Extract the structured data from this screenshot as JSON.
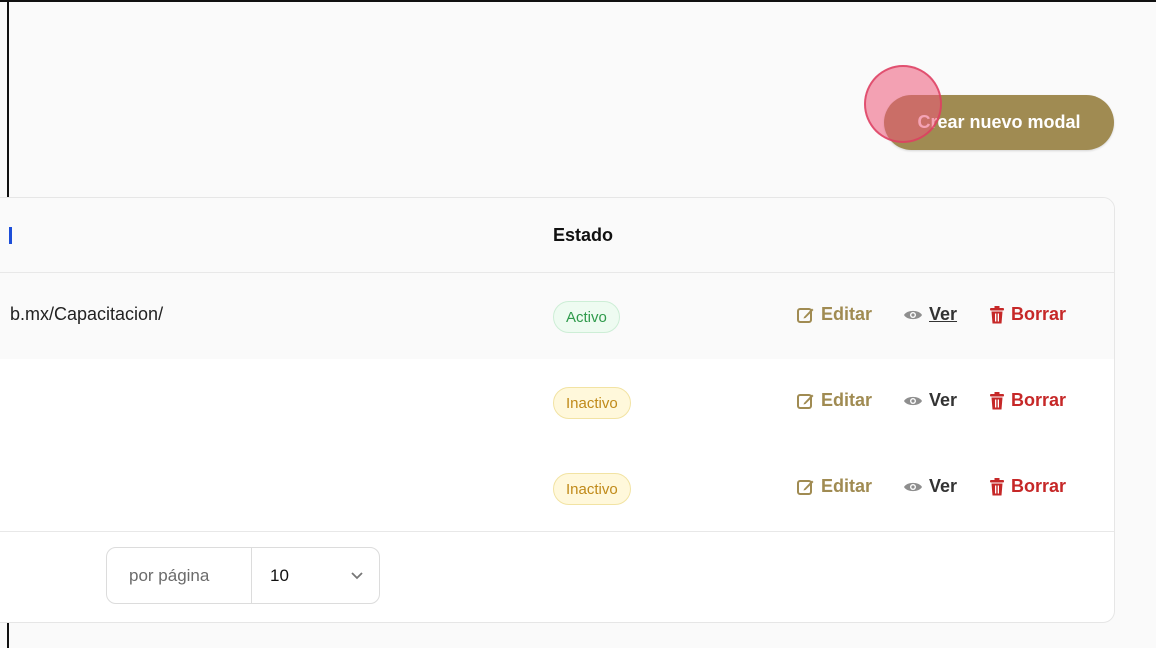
{
  "header": {
    "create_button_label": "Crear nuevo modal"
  },
  "table": {
    "columns": {
      "estado": "Estado"
    },
    "rows": [
      {
        "url": "b.mx/Capacitacion/",
        "status": "Activo",
        "status_type": "active"
      },
      {
        "url": "",
        "status": "Inactivo",
        "status_type": "inactive"
      },
      {
        "url": "",
        "status": "Inactivo",
        "status_type": "inactive"
      }
    ],
    "actions": {
      "edit": "Editar",
      "view": "Ver",
      "delete": "Borrar"
    }
  },
  "pagination": {
    "per_page_label": "por página",
    "per_page_value": "10"
  },
  "colors": {
    "accent": "#a08b52",
    "danger": "#c62828",
    "active": "#2f9a4b",
    "inactive": "#c08a19"
  }
}
